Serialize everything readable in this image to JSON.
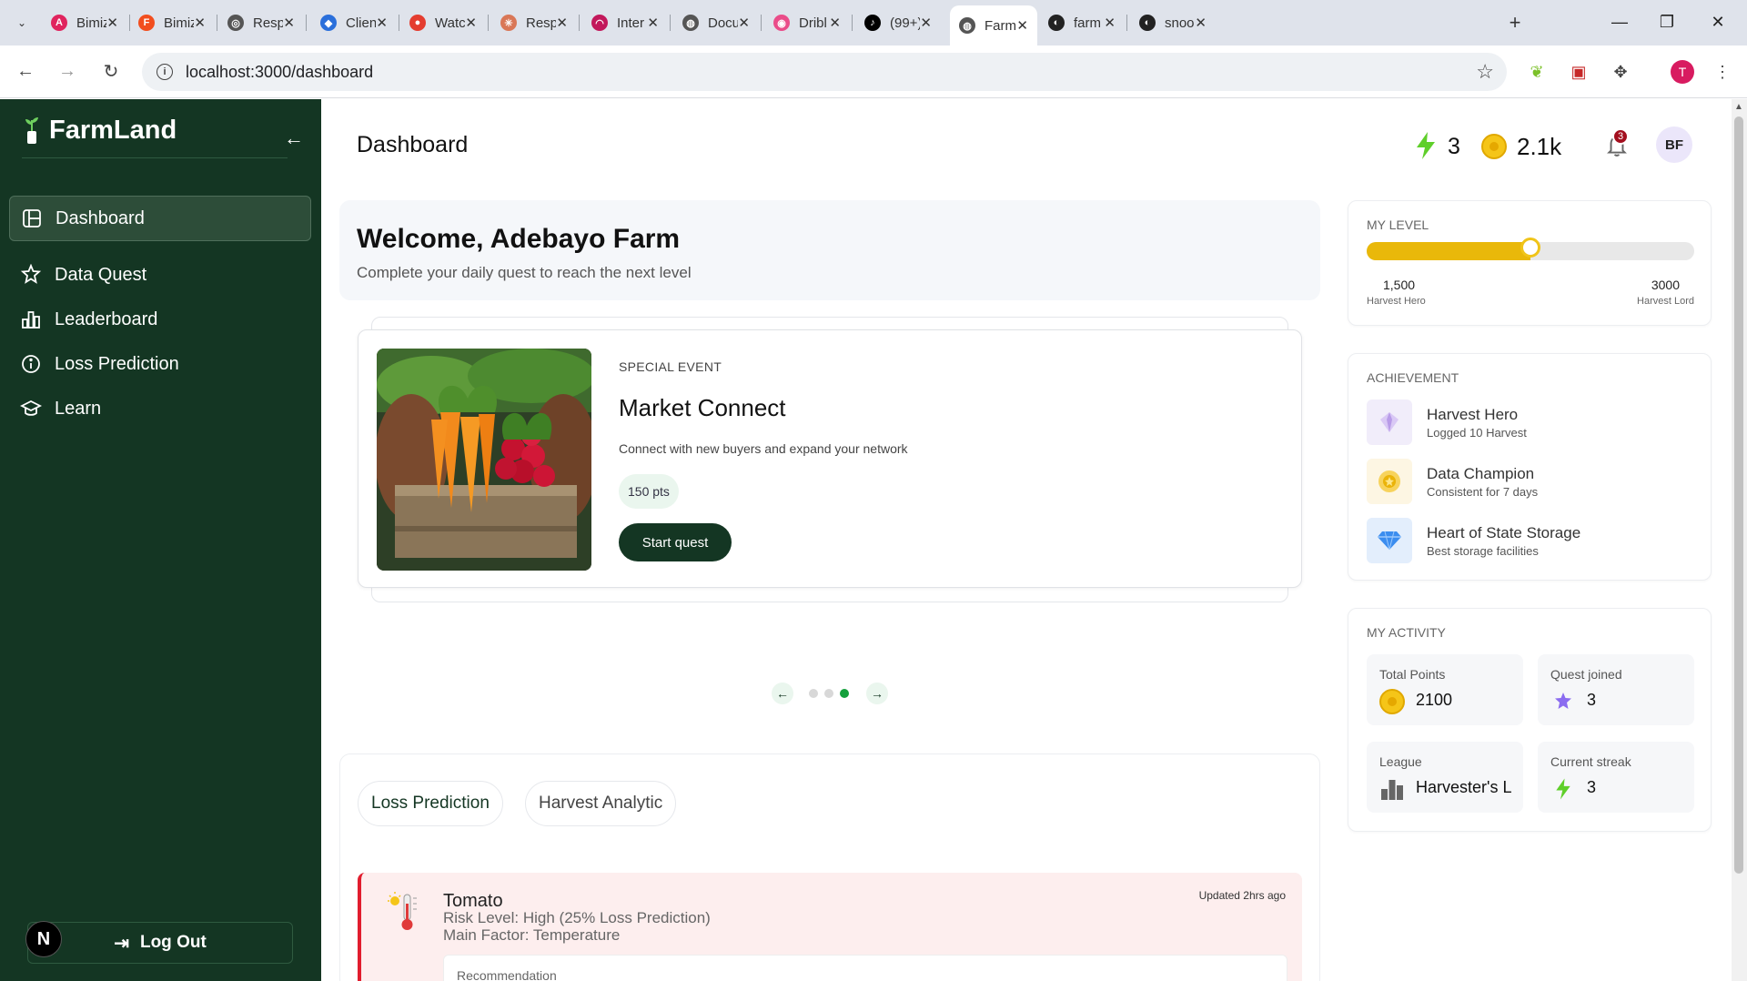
{
  "browser": {
    "tabs": [
      {
        "label": "Bimiz",
        "color": "#e0245e",
        "glyph": "A"
      },
      {
        "label": "Bimiz",
        "color": "#f24e1e",
        "glyph": "F"
      },
      {
        "label": "Resp",
        "color": "#555555",
        "glyph": "◎"
      },
      {
        "label": "Clien",
        "color": "#2a6fdb",
        "glyph": "◆"
      },
      {
        "label": "Watc",
        "color": "#e43d30",
        "glyph": "●"
      },
      {
        "label": "Resp",
        "color": "#d97757",
        "glyph": "✳"
      },
      {
        "label": "Inter",
        "color": "#c2185b",
        "glyph": "◠"
      },
      {
        "label": "Docu",
        "color": "#555555",
        "glyph": "◍"
      },
      {
        "label": "Dribl",
        "color": "#ea4c89",
        "glyph": "◉"
      },
      {
        "label": "(99+)",
        "color": "#000000",
        "glyph": "♪"
      },
      {
        "label": "Farm",
        "color": "#555555",
        "glyph": "◍",
        "active": true
      },
      {
        "label": "farm",
        "color": "#222222",
        "glyph": "◐"
      },
      {
        "label": "snoo",
        "color": "#222222",
        "glyph": "◐"
      }
    ],
    "url": "localhost:3000/dashboard",
    "profile_initial": "T"
  },
  "sidebar": {
    "brand": "FarmLand",
    "items": [
      {
        "label": "Dashboard",
        "icon": "layout-icon",
        "active": true
      },
      {
        "label": "Data Quest",
        "icon": "quest-icon"
      },
      {
        "label": "Leaderboard",
        "icon": "chart-bars-icon"
      },
      {
        "label": "Loss Prediction",
        "icon": "info-circle-icon"
      },
      {
        "label": "Learn",
        "icon": "graduation-cap-icon"
      }
    ],
    "logout_label": "Log Out",
    "corner_badge": "N"
  },
  "header": {
    "title": "Dashboard",
    "streak": "3",
    "points": "2.1k",
    "notifications": "3",
    "avatar_initials": "BF"
  },
  "welcome": {
    "title": "Welcome, Adebayo Farm",
    "subtitle": "Complete your daily quest to reach the next level"
  },
  "event": {
    "kicker": "SPECIAL EVENT",
    "title": "Market Connect",
    "description": "Connect with new buyers and expand your network",
    "points": "150 pts",
    "cta": "Start quest",
    "carousel_active_index": 2,
    "carousel_count": 3
  },
  "tabs": {
    "items": [
      "Loss Prediction",
      "Harvest Analytic"
    ],
    "active": 0
  },
  "prediction": {
    "crop": "Tomato",
    "risk": "Risk Level: High (25% Loss Prediction)",
    "factor": "Main Factor: Temperature",
    "updated": "Updated 2hrs ago",
    "recommendation_label": "Recommendation"
  },
  "level": {
    "heading": "MY LEVEL",
    "progress": 0.5,
    "current_value": "1,500",
    "current_label": "Harvest Hero",
    "next_value": "3000",
    "next_label": "Harvest Lord",
    "bar_color": "#e9b80a"
  },
  "achievements": {
    "heading": "ACHIEVEMENT",
    "items": [
      {
        "title": "Harvest Hero",
        "subtitle": "Logged 10 Harvest",
        "icon": "gem-purple-icon"
      },
      {
        "title": "Data Champion",
        "subtitle": "Consistent for 7 days",
        "icon": "medal-gold-icon"
      },
      {
        "title": "Heart of State Storage",
        "subtitle": "Best storage facilities",
        "icon": "diamond-blue-icon"
      }
    ]
  },
  "activity": {
    "heading": "MY ACTIVITY",
    "total_points_label": "Total Points",
    "total_points": "2100",
    "quest_label": "Quest joined",
    "quest_value": "3",
    "league_label": "League",
    "league_value": "Harvester's L",
    "streak_label": "Current streak",
    "streak_value": "3"
  },
  "colors": {
    "sidebar": "#143623",
    "accent": "#14a03c",
    "danger": "#e11d2e"
  }
}
